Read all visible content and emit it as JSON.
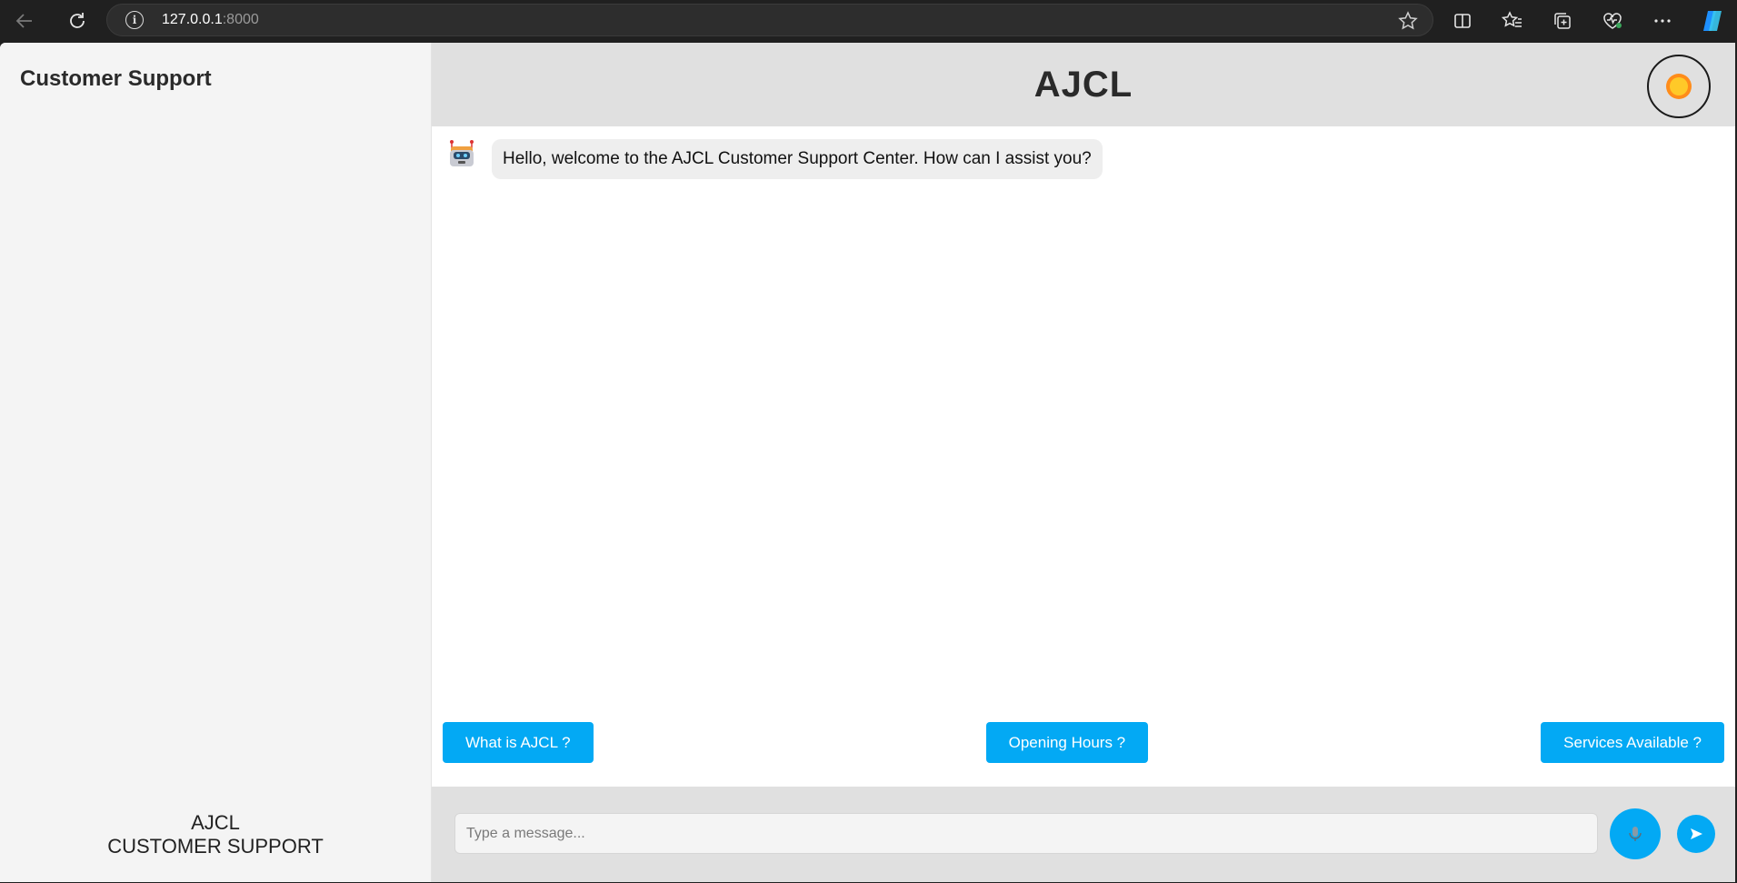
{
  "browser": {
    "url_host": "127.0.0.1",
    "url_port": ":8000"
  },
  "sidebar": {
    "title": "Customer Support",
    "footer_line1": "AJCL",
    "footer_line2": "CUSTOMER SUPPORT"
  },
  "header": {
    "title": "AJCL",
    "theme_icon": "sun-icon"
  },
  "messages": [
    {
      "sender": "bot",
      "avatar_icon": "robot-icon",
      "text": "Hello, welcome to the AJCL Customer Support Center. How can I assist you?"
    }
  ],
  "quick_replies": [
    "What is AJCL ?",
    "Opening Hours ?",
    "Services Available ?"
  ],
  "composer": {
    "placeholder": "Type a message...",
    "mic_icon": "microphone-icon",
    "send_icon": "send-icon"
  },
  "colors": {
    "accent": "#03a9f4",
    "header_bg": "#e0e0e0",
    "sidebar_bg": "#f4f4f4"
  }
}
